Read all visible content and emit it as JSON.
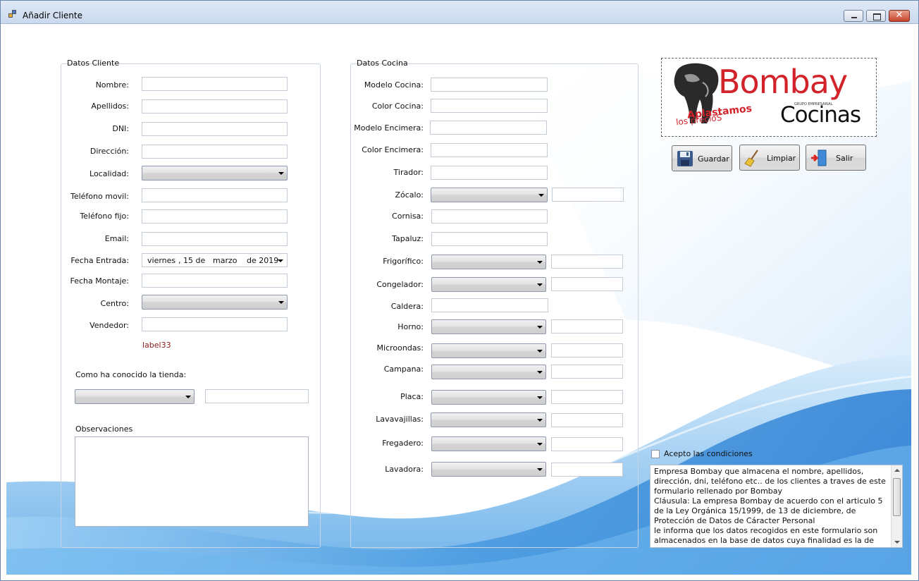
{
  "window": {
    "title": "Añadir Cliente"
  },
  "datos_cliente": {
    "group_title": "Datos Cliente",
    "labels": {
      "nombre": "Nombre:",
      "apellidos": "Apellidos:",
      "dni": "DNI:",
      "direccion": "Dirección:",
      "localidad": "Localidad:",
      "telefono_movil": "Teléfono movil:",
      "telefono_fijo": "Teléfono fijo:",
      "email": "Email:",
      "fecha_entrada": "Fecha Entrada:",
      "fecha_montaje": "Fecha Montaje:",
      "centro": "Centro:",
      "vendedor": "Vendedor:"
    },
    "fecha_entrada": {
      "weekday": "viernes",
      "day": ", 15 de",
      "month": "marzo",
      "year": "de 2019"
    },
    "label33": "label33",
    "como_conocido": "Como ha conocido la tienda:",
    "observaciones": "Observaciones"
  },
  "datos_cocina": {
    "group_title": "Datos Cocina",
    "labels": {
      "modelo_cocina": "Modelo Cocina:",
      "color_cocina": "Color Cocina:",
      "modelo_encimera": "Modelo Encimera:",
      "color_encimera": "Color Encimera:",
      "tirador": "Tirador:",
      "zocalo": "Zócalo:",
      "cornisa": "Cornisa:",
      "tapaluz": "Tapaluz:",
      "frigorifico": "Frigorífico:",
      "congelador": "Congelador:",
      "caldera": "Caldera:",
      "horno": "Horno:",
      "microondas": "Microondas:",
      "campana": "Campana:",
      "placa": "Placa:",
      "lavavajillas": "Lavavajillas:",
      "fregadero": "Fregadero:",
      "lavadora": "Lavadora:"
    }
  },
  "logo": {
    "brand": "Bombay",
    "sub": "Cocinas",
    "grupo": "GRUPO EMPRESARIAL",
    "tag1": "Aplastamos",
    "tag2": "los precioS"
  },
  "buttons": {
    "guardar": "Guardar",
    "limpiar": "Limpiar",
    "salir": "Salir"
  },
  "terms": {
    "checkbox_label": "Acepto las condiciones",
    "text": "Empresa Bombay que almacena el nombre, apellidos, dirección, dni, teléfono etc.. de los clientes a traves de este formulario rellenado por Bombay\nCláusula: La empresa Bombay de acuerdo con el articulo 5 de la Ley Orgánica 15/1999, de 13 de diciembre, de Protección de Datos de Cáracter Personal\nle informa que los datos recogidos en este formulario son almacenados en la base de datos cuya finalidad es la de"
  },
  "colors": {
    "label33": "#8b1a1a",
    "logo_red": "#d2232a",
    "background_wave": "#4a9be0"
  }
}
